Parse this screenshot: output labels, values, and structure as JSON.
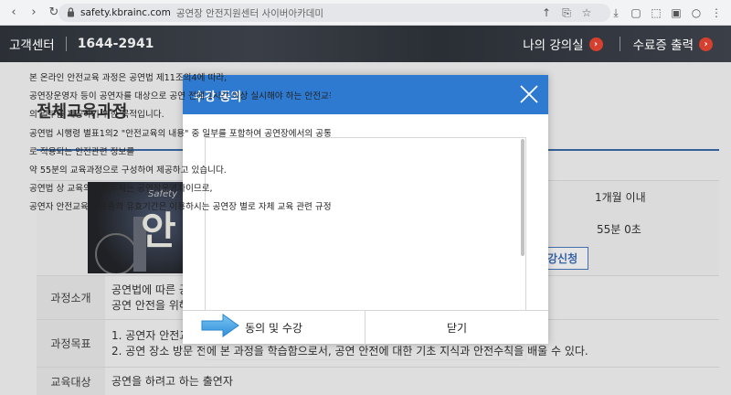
{
  "browser": {
    "url_host": "safety.kbrainc.com",
    "url_title": "공연장 안전지원센터 사이버아카데미",
    "icons": [
      "back-icon",
      "forward-icon",
      "reload-icon",
      "tab-icon",
      "lock-icon",
      "share-icon",
      "translate-icon",
      "star-icon",
      "download-icon",
      "media-icon",
      "screenshot-icon",
      "extension-icon",
      "profile-icon",
      "menu-icon"
    ]
  },
  "header": {
    "support_label": "고객센터",
    "phone": "1644-2941",
    "my_classroom": "나의 강의실",
    "certificate": "수료증 출력",
    "accent": "#d6402e"
  },
  "page": {
    "title": "전체교육과정",
    "info_value_1": "1개월 이내",
    "info_value_2": "55분 0초",
    "apply_label": "강신청",
    "thumb_text": "안",
    "thumb_sub": "Safety",
    "rows": [
      {
        "label": "과정소개",
        "lines": [
          "공연법에 따른 공",
          "공연 안전을 위해"
        ]
      },
      {
        "label": "과정목표",
        "lines": [
          "1. 공연자 안전교",
          "2. 공연 장소 방문 전에 본 과정을 학습함으로서, 공연 안전에 대한 기초 지식과 안전수칙을 배울 수 있다."
        ]
      },
      {
        "label": "교육대상",
        "lines": [
          "공연을 하려고 하는 출연자"
        ]
      }
    ]
  },
  "modal": {
    "title": "수강 동의",
    "header_color": "#2e7ad1",
    "lines": [
      "본 온라인 안전교육 과정은 공연법 제11조의4에 따라,",
      "공연장운영자 등이 공연자를 대상으로 공연 전에 1시간 이상 실시해야 하는 안전교육",
      "의 일부를 제공하기 위한 목적입니다.",
      "공연법 시행령 별표1의2 \"안전교육의 내용\" 중 일부를 포함하여 공연장에서의 공통으",
      "로 적용되는 안전관련 정보를",
      "약 55분의 교육과정으로 구성하여 제공하고 있습니다.",
      "공연법 상 교육의 시행주체는 공연장운영자이므로,",
      "공연자 안전교육 수료증의 유효기간은 이용하시는 공연장 별로 자체 교육 관련 규정이"
    ],
    "agree_label": "동의 및 수강",
    "close_label": "닫기"
  }
}
